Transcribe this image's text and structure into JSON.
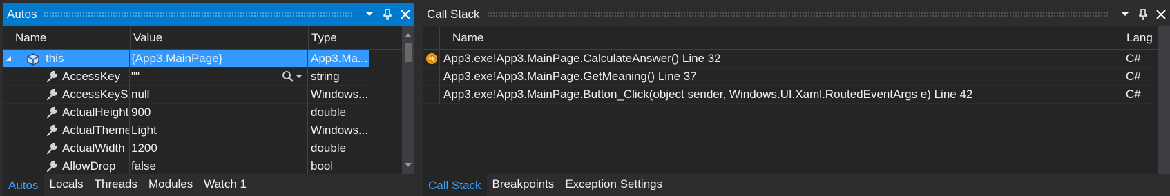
{
  "autos": {
    "title": "Autos",
    "columns": {
      "name": "Name",
      "value": "Value",
      "type": "Type"
    },
    "rows": [
      {
        "name": "this",
        "value": "{App3.MainPage}",
        "type": "App3.Ma..."
      },
      {
        "name": "AccessKey",
        "value": "\"\"",
        "type": "string"
      },
      {
        "name": "AccessKeyS...",
        "value": "null",
        "type": "Windows..."
      },
      {
        "name": "ActualHeight",
        "value": "900",
        "type": "double"
      },
      {
        "name": "ActualTheme",
        "value": "Light",
        "type": "Windows..."
      },
      {
        "name": "ActualWidth",
        "value": "1200",
        "type": "double"
      },
      {
        "name": "AllowDrop",
        "value": "false",
        "type": "bool"
      }
    ],
    "tabs": [
      "Autos",
      "Locals",
      "Threads",
      "Modules",
      "Watch 1"
    ]
  },
  "callstack": {
    "title": "Call Stack",
    "columns": {
      "name": "Name",
      "lang": "Lang"
    },
    "rows": [
      {
        "name": "App3.exe!App3.MainPage.CalculateAnswer() Line 32",
        "lang": "C#"
      },
      {
        "name": "App3.exe!App3.MainPage.GetMeaning() Line 37",
        "lang": "C#"
      },
      {
        "name": "App3.exe!App3.MainPage.Button_Click(object sender, Windows.UI.Xaml.RoutedEventArgs e) Line 42",
        "lang": "C#"
      }
    ],
    "tabs": [
      "Call Stack",
      "Breakpoints",
      "Exception Settings"
    ]
  },
  "icons": {
    "dropdown": "chevron-down-icon",
    "pin": "pin-icon",
    "close": "close-icon",
    "expand": "expand-triangle-icon",
    "object": "object-icon",
    "property": "wrench-icon",
    "magnifier": "magnifier-icon",
    "current_frame": "current-frame-arrow-icon"
  },
  "colors": {
    "accent": "#007acc",
    "selection": "#3399ff",
    "active_tab_text": "#3aa0ff"
  }
}
